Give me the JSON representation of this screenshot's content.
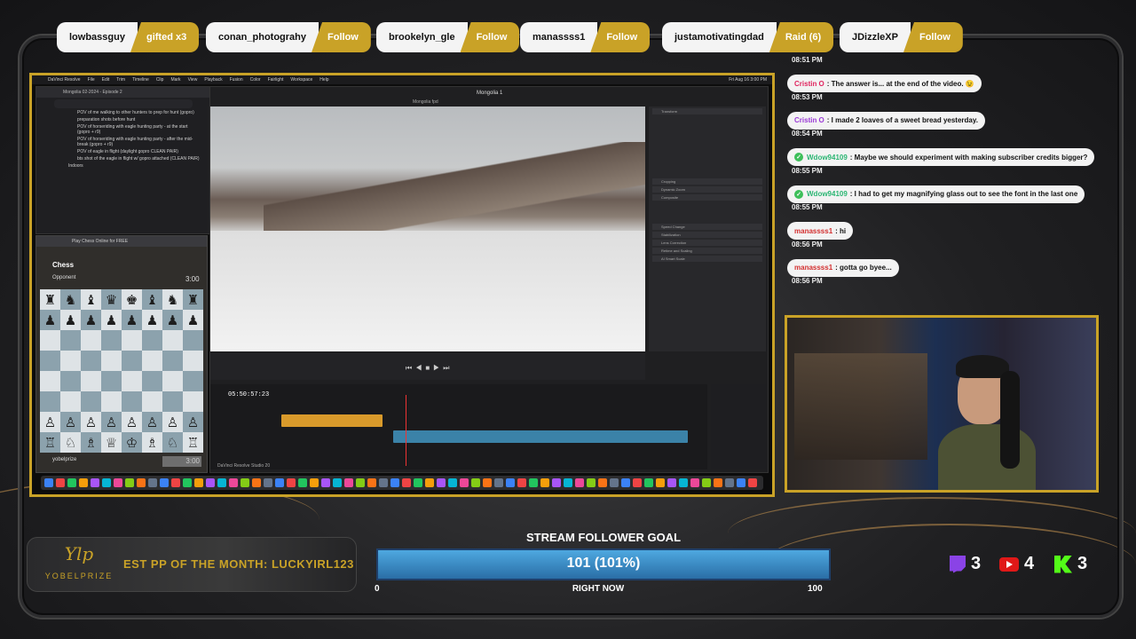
{
  "top_bar": [
    {
      "name": "lowbassguy",
      "tag": "gifted x3"
    },
    {
      "name": "conan_photograhy",
      "tag": "Follow"
    },
    {
      "name": "brookelyn_gle",
      "tag": "Follow"
    },
    {
      "name": "manassss1",
      "tag": "Follow"
    },
    {
      "name": "justamotivatingdad",
      "tag": "Raid (6)"
    },
    {
      "name": "JDizzleXP",
      "tag": "Follow"
    }
  ],
  "screen": {
    "menubar": [
      "DaVinci Resolve",
      "File",
      "Edit",
      "Trim",
      "Timeline",
      "Clip",
      "Mark",
      "View",
      "Playback",
      "Fusion",
      "Color",
      "Fairlight",
      "Workspace",
      "Help"
    ],
    "clock": "Fri Aug 16  3:00 PM",
    "resolve_project": "Mongolia 1",
    "timecode": "05:50:57:23",
    "viewer_label": "Mongolia fpd",
    "resolve_footer": "DaVinci Resolve Studio 20",
    "inspector_sections": [
      "Transform",
      "Cropping",
      "Dynamic Zoom",
      "Composite",
      "Speed Change",
      "Stabilization",
      "Lens Correction",
      "Retime and Scaling",
      "AI Smart Scale"
    ],
    "docs": {
      "tab": "Mongolia 02-2024 - Episode 2",
      "lines": [
        "POV of me walking to other hunters to prep for hunt (gopro)",
        "preparation shots before hunt",
        "POV of horseriding with eagle hunting party - at the start (gopro + r9)",
        "POV of horseriding with eagle hunting party - after the mid-break (gopro + r9)",
        "POV of eagle in flight (daylight gopro CLEAN PAIR)",
        "bts shot of the eagle in flight w/ gopro attached (CLEAN PAIR)",
        "Indoors"
      ]
    },
    "chess": {
      "tab": "Play Chess Online for FREE",
      "opponent": "Opponent",
      "opponent_time": "3:00",
      "player": "yobelprize",
      "player_time": "3:00",
      "brand": "Chess"
    }
  },
  "chat": [
    {
      "time": "08:51 PM",
      "user": "Cristin O",
      "user_color": "#e0245e",
      "text": ": The answer is... at the end of the video. 😉",
      "icon": ""
    },
    {
      "time": "08:53 PM",
      "user": "Cristin O",
      "user_color": "#9b3ad6",
      "text": ": I made 2 loaves of a sweet bread yesterday.",
      "icon": ""
    },
    {
      "time": "08:54 PM",
      "user": "Wdow94109",
      "user_color": "#2bb673",
      "text": ": Maybe we should experiment with making subscriber credits bigger?",
      "icon": "✓"
    },
    {
      "time": "08:55 PM",
      "user": "Wdow94109",
      "user_color": "#2bb673",
      "text": ": I had to get my magnifying glass out to see the font in the last one",
      "icon": "✓"
    },
    {
      "time": "08:55 PM",
      "user": "manassss1",
      "user_color": "#d32f2f",
      "text": ": hi",
      "icon": ""
    },
    {
      "time": "08:56 PM",
      "user": "manassss1",
      "user_color": "#d32f2f",
      "text": ": gotta go byee...",
      "icon": ""
    },
    {
      "time": "08:56 PM",
      "user": "",
      "user_color": "",
      "text": "",
      "icon": ""
    }
  ],
  "prize": {
    "logo": "Ylp",
    "sub": "YOBELPRIZE",
    "text": "EST PP OF THE MONTH: LUCKYIRL123"
  },
  "goal": {
    "title": "STREAM FOLLOWER GOAL",
    "value_text": "101 (101%)",
    "progress": 1.0,
    "min": "0",
    "max": "100",
    "now": "RIGHT NOW"
  },
  "counters": [
    {
      "platform": "twitch-icon",
      "count": "3"
    },
    {
      "platform": "youtube-icon",
      "count": "4"
    },
    {
      "platform": "kick-icon",
      "count": "3"
    }
  ],
  "colors": {
    "gold": "#c9a227",
    "goal_fill": "#4ea8e0"
  }
}
